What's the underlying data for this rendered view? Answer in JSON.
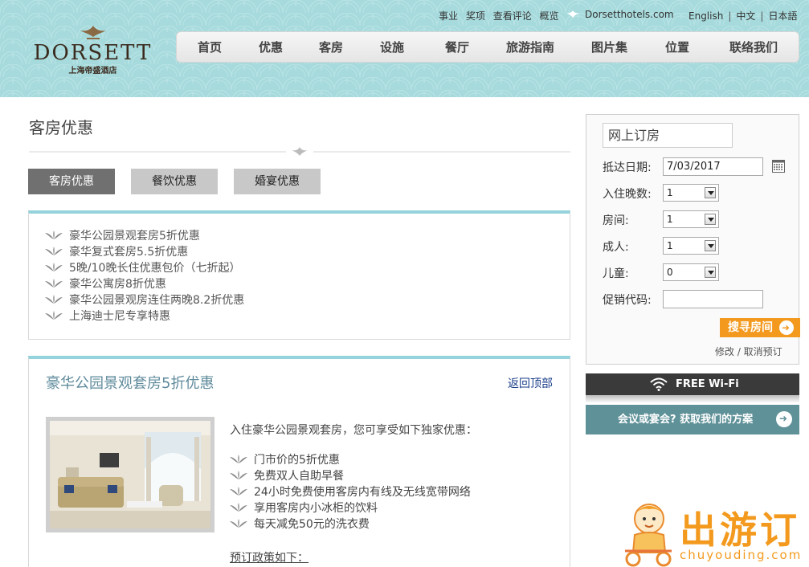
{
  "header": {
    "logo": {
      "brand": "DORSETT",
      "subtitle": "上海帝盛酒店"
    },
    "top_links": [
      "事业",
      "奖项",
      "查看评论",
      "概览"
    ],
    "site_link": "Dorsetthotels.com",
    "languages": [
      "English",
      "中文",
      "日本語"
    ],
    "nav": [
      "首页",
      "优惠",
      "客房",
      "设施",
      "餐厅",
      "旅游指南",
      "图片集",
      "位置",
      "联络我们"
    ]
  },
  "main": {
    "page_title": "客房优惠",
    "tabs": [
      {
        "label": "客房优惠",
        "active": true
      },
      {
        "label": "餐饮优惠",
        "active": false
      },
      {
        "label": "婚宴优惠",
        "active": false
      }
    ],
    "offers": [
      "豪华公园景观套房5折优惠",
      "豪华复式套房5.5折优惠",
      "5晚/10晚长住优惠包价（七折起）",
      "豪华公寓房8折优惠",
      "豪华公园景观房连住两晚8.2折优惠",
      "上海迪士尼专享特惠"
    ],
    "offer_detail": {
      "title": "豪华公园景观套房5折优惠",
      "back_to_top": "返回顶部",
      "intro": "入住豪华公园景观套房，您可享受如下独家优惠：",
      "perks": [
        "门市价的5折优惠",
        "免费双人自助早餐",
        "24小时免费使用客房内有线及无线宽带网络",
        "享用客房内小冰柜的饮料",
        "每天减免50元的洗衣费"
      ],
      "policy_heading": "预订政策如下："
    }
  },
  "booking": {
    "title": "网上订房",
    "arrival_label": "抵达日期:",
    "arrival_value": "7/03/2017",
    "nights_label": "入住晚数:",
    "nights_value": "1",
    "rooms_label": "房间:",
    "rooms_value": "1",
    "adults_label": "成人:",
    "adults_value": "1",
    "children_label": "儿童:",
    "children_value": "0",
    "promo_label": "促销代码:",
    "search_button": "搜寻房间",
    "modify_link": "修改 / 取消预订"
  },
  "sidebar": {
    "wifi": "FREE Wi-Fi",
    "meeting": "会议或宴会? 获取我们的方案"
  },
  "watermark": {
    "cn": "出游订",
    "en": "chuyouding.com"
  },
  "colors": {
    "header_bg": "#a6dadc",
    "accent_teal": "#94d3dc",
    "orange": "#f39a1e",
    "meeting_bar": "#5f9198",
    "active_tab": "#707070"
  }
}
